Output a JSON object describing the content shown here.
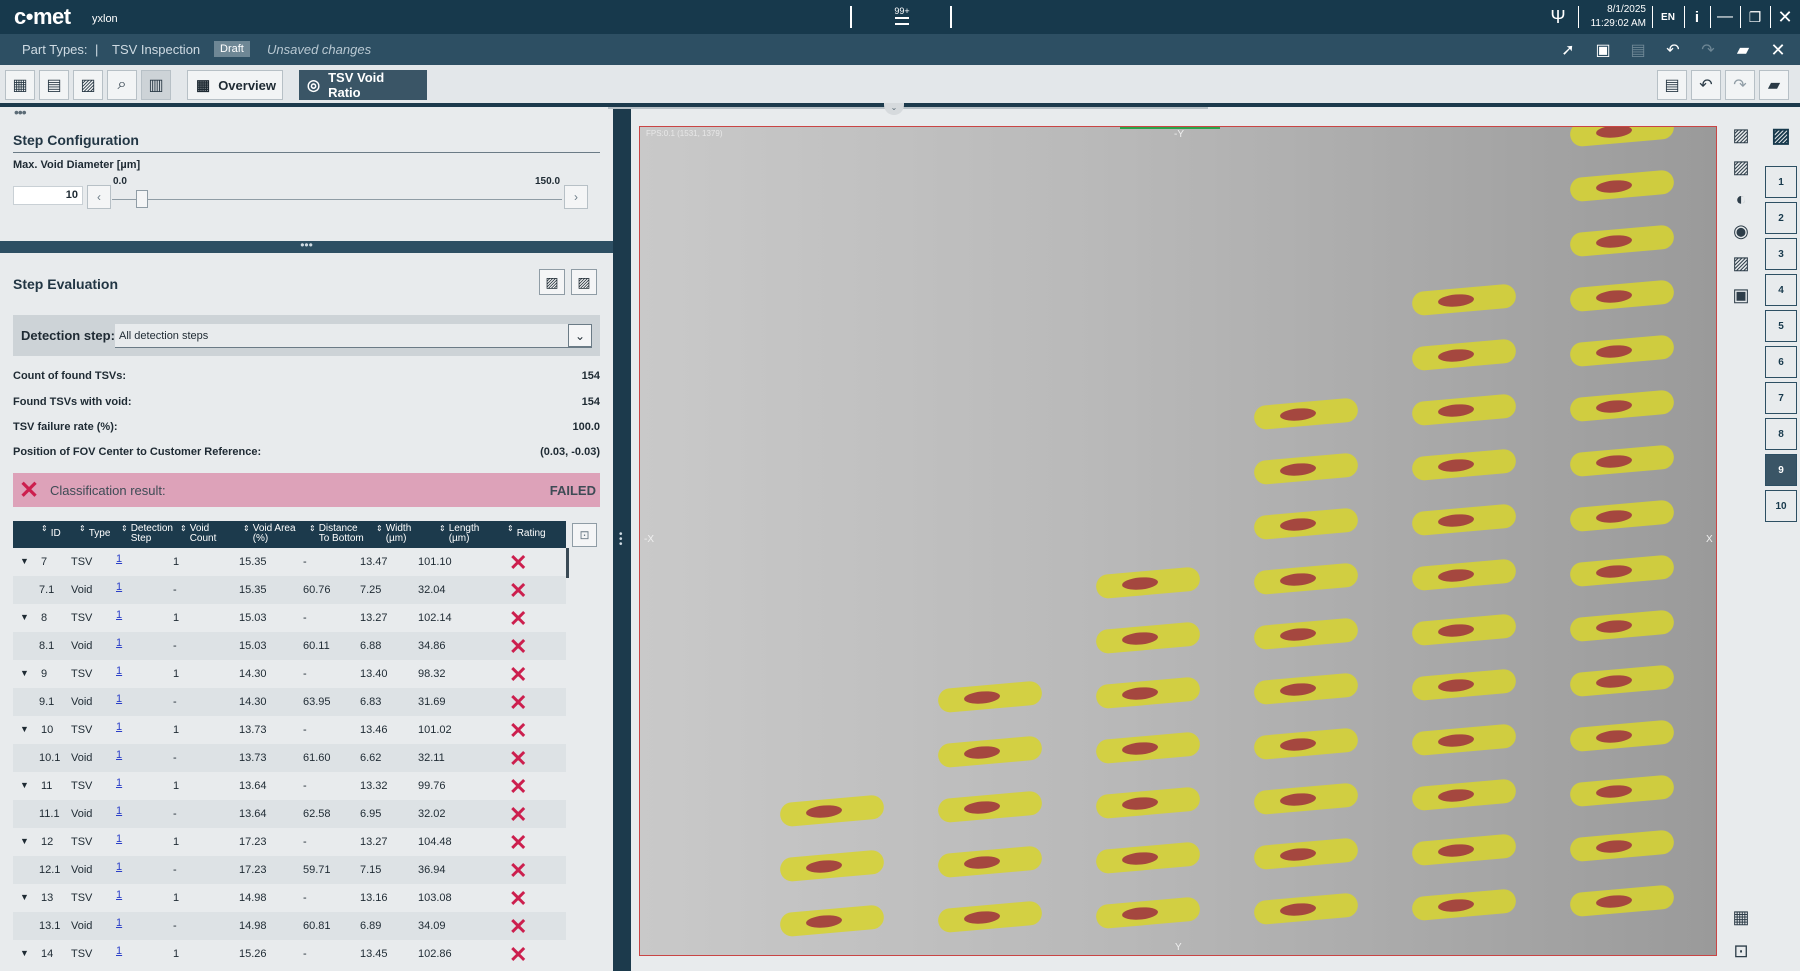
{
  "app": {
    "logo": "c•met",
    "sublogo": "yxlon",
    "notif": "99+",
    "date": "8/1/2025",
    "time": "11:29:02 AM",
    "lang": "EN"
  },
  "header": {
    "part_types": "Part Types:",
    "sep": "|",
    "title": "TSV Inspection",
    "badge": "Draft",
    "status": "Unsaved changes"
  },
  "tabs": {
    "overview": "Overview",
    "active": "TSV Void Ratio"
  },
  "step_config": {
    "title": "Step Configuration",
    "slider_label": "Max. Void Diameter [µm]",
    "value": "10",
    "min": "0.0",
    "max": "150.0",
    "slider_fraction": 0.067
  },
  "step_eval": {
    "title": "Step Evaluation",
    "detection_label": "Detection step:",
    "detection_value": "All detection steps",
    "stats": [
      {
        "label": "Count of found TSVs:",
        "value": "154"
      },
      {
        "label": "Found TSVs with void:",
        "value": "154"
      },
      {
        "label": "TSV failure rate (%):",
        "value": "100.0"
      },
      {
        "label": "Position of FOV Center to Customer Reference:",
        "value": "(0.03, -0.03)"
      }
    ],
    "result_label": "Classification result:",
    "result_value": "FAILED"
  },
  "table": {
    "headers": [
      "ID",
      "Type",
      "Detection\nStep",
      "Void\nCount",
      "Void Area\n(%)",
      "Distance\nTo Bottom",
      "Width\n(µm)",
      "Length\n(µm)",
      "Rating"
    ],
    "rows": [
      {
        "id": "7",
        "type": "TSV",
        "step": "1",
        "count": "1",
        "area": "15.35",
        "dist": "-",
        "width": "13.47",
        "length": "101.10",
        "parent": true
      },
      {
        "id": "7.1",
        "type": "Void",
        "step": "1",
        "count": "-",
        "area": "15.35",
        "dist": "60.76",
        "width": "7.25",
        "length": "32.04",
        "parent": false
      },
      {
        "id": "8",
        "type": "TSV",
        "step": "1",
        "count": "1",
        "area": "15.03",
        "dist": "-",
        "width": "13.27",
        "length": "102.14",
        "parent": true
      },
      {
        "id": "8.1",
        "type": "Void",
        "step": "1",
        "count": "-",
        "area": "15.03",
        "dist": "60.11",
        "width": "6.88",
        "length": "34.86",
        "parent": false
      },
      {
        "id": "9",
        "type": "TSV",
        "step": "1",
        "count": "1",
        "area": "14.30",
        "dist": "-",
        "width": "13.40",
        "length": "98.32",
        "parent": true
      },
      {
        "id": "9.1",
        "type": "Void",
        "step": "1",
        "count": "-",
        "area": "14.30",
        "dist": "63.95",
        "width": "6.83",
        "length": "31.69",
        "parent": false
      },
      {
        "id": "10",
        "type": "TSV",
        "step": "1",
        "count": "1",
        "area": "13.73",
        "dist": "-",
        "width": "13.46",
        "length": "101.02",
        "parent": true
      },
      {
        "id": "10.1",
        "type": "Void",
        "step": "1",
        "count": "-",
        "area": "13.73",
        "dist": "61.60",
        "width": "6.62",
        "length": "32.11",
        "parent": false
      },
      {
        "id": "11",
        "type": "TSV",
        "step": "1",
        "count": "1",
        "area": "13.64",
        "dist": "-",
        "width": "13.32",
        "length": "99.76",
        "parent": true
      },
      {
        "id": "11.1",
        "type": "Void",
        "step": "1",
        "count": "-",
        "area": "13.64",
        "dist": "62.58",
        "width": "6.95",
        "length": "32.02",
        "parent": false
      },
      {
        "id": "12",
        "type": "TSV",
        "step": "1",
        "count": "1",
        "area": "17.23",
        "dist": "-",
        "width": "13.27",
        "length": "104.48",
        "parent": true
      },
      {
        "id": "12.1",
        "type": "Void",
        "step": "1",
        "count": "-",
        "area": "17.23",
        "dist": "59.71",
        "width": "7.15",
        "length": "36.94",
        "parent": false
      },
      {
        "id": "13",
        "type": "TSV",
        "step": "1",
        "count": "1",
        "area": "14.98",
        "dist": "-",
        "width": "13.16",
        "length": "103.08",
        "parent": true
      },
      {
        "id": "13.1",
        "type": "Void",
        "step": "1",
        "count": "-",
        "area": "14.98",
        "dist": "60.81",
        "width": "6.89",
        "length": "34.09",
        "parent": false
      },
      {
        "id": "14",
        "type": "TSV",
        "step": "1",
        "count": "1",
        "area": "15.26",
        "dist": "-",
        "width": "13.45",
        "length": "102.86",
        "parent": true
      }
    ]
  },
  "viewer": {
    "fov_readout": "FPS:0.1  (1531, 1379)",
    "axis_top": "-Y",
    "axis_bottom": "Y",
    "axis_left": "-X",
    "axis_right": "X"
  },
  "steps": [
    "1",
    "2",
    "3",
    "4",
    "5",
    "6",
    "7",
    "8",
    "9",
    "10"
  ],
  "active_step": "9",
  "colors": {
    "accent": "#17394c",
    "fail": "#cc1f4e",
    "fail_bg": "#dda2b9",
    "tsv_fill": "#d6d332",
    "void_fill": "#a5473f"
  }
}
